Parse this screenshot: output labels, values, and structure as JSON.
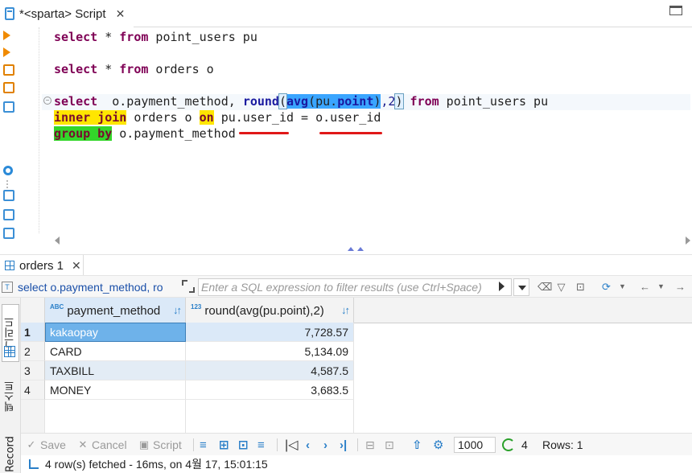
{
  "editor_tab": {
    "title": "*<sparta> Script",
    "close": "✕"
  },
  "sql": {
    "line1": {
      "kw1": "select",
      "rest": " * ",
      "kw2": "from",
      "tail": " point_users pu"
    },
    "line2": {
      "kw1": "select",
      "rest": " * ",
      "kw2": "from",
      "tail": " orders o"
    },
    "line3": {
      "kw1": "select",
      "a": "  o.payment_method, ",
      "fn1": "round",
      "p1": "(",
      "fn2": "avg",
      "p2": "(pu.",
      "f": "point",
      "p3": ")",
      "n": ",2",
      "p4": ")",
      "sp": " ",
      "kw2": "from",
      "tail": " point_users pu"
    },
    "line4": {
      "kw1": "inner join",
      "a": " orders o ",
      "kw2": "on",
      "b": " pu.user_id = o.user_id"
    },
    "line5": {
      "kw1": "group by",
      "a": " o.payment_method"
    }
  },
  "results_tab": {
    "title": "orders 1",
    "close": "✕"
  },
  "filterbar": {
    "query_label": "select o.payment_method, ro",
    "filter_placeholder": "Enter a SQL expression to filter results (use Ctrl+Space)"
  },
  "side_tabs": {
    "grid": "그리드",
    "text": "텍스트",
    "record": "Record"
  },
  "grid": {
    "columns": [
      {
        "type_badge": "ABC",
        "name": "payment_method"
      },
      {
        "type_badge": "123",
        "name": "round(avg(pu.point),2)"
      }
    ],
    "rows": [
      {
        "num": "1",
        "payment_method": "kakaopay",
        "value": "7,728.57"
      },
      {
        "num": "2",
        "payment_method": "CARD",
        "value": "5,134.09"
      },
      {
        "num": "3",
        "payment_method": "TAXBILL",
        "value": "4,587.5"
      },
      {
        "num": "4",
        "payment_method": "MONEY",
        "value": "3,683.5"
      }
    ],
    "selected_row": 1
  },
  "bottombar": {
    "save": "Save",
    "cancel": "Cancel",
    "script": "Script",
    "fetch_size": "1000",
    "fetched_count": "4",
    "rows_label": "Rows: 1"
  },
  "status": {
    "text": "4 row(s) fetched - 16ms, on 4월 17, 15:01:15"
  },
  "colors": {
    "keyword": "#7f0055",
    "highlight_yellow": "#ffe600",
    "highlight_green": "#33d62a",
    "highlight_blue": "#3aa5ff",
    "error_underline": "#e01818",
    "selection": "#6eb2ea",
    "accent": "#2a7fc8"
  },
  "icons": [
    "script-icon",
    "close-icon",
    "minimize-icon",
    "run-icon",
    "execute-script-icon",
    "explain-icon",
    "gear-icon",
    "grid-icon",
    "expand-icon",
    "filter-history-icon",
    "refresh-icon",
    "sort-filter-icon"
  ]
}
